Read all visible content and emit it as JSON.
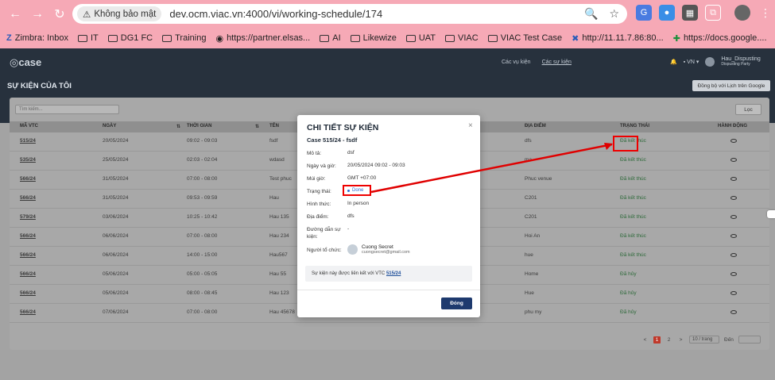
{
  "browser": {
    "security_label": "Không bảo mật",
    "url": "dev.ocm.viac.vn:4000/vi/working-schedule/174",
    "bookmarks": [
      "Zimbra: Inbox",
      "IT",
      "DG1 FC",
      "Training",
      "https://partner.elsas...",
      "AI",
      "Likewize",
      "UAT",
      "VIAC",
      "VIAC Test Case",
      "http://11.11.7.86:80...",
      "https://docs.google...."
    ]
  },
  "app": {
    "logo": "case",
    "nav": [
      "Các vụ kiện",
      "Các sự kiện"
    ],
    "language": "VN",
    "user_name": "Hau_Dispusting",
    "user_sub": "Dispusting Party",
    "page_title": "SỰ KIỆN CỦA TÔI",
    "sync_button": "Đồng bộ với Lịch trên Google",
    "search_placeholder": "Tìm kiếm...",
    "filter_button": "Lọc",
    "columns": [
      "MÃ VTC",
      "NGÀY",
      "THỜI GIAN",
      "TÊN",
      "ĐỊA ĐIỂM",
      "TRẠNG THÁI",
      "HÀNH ĐỘNG"
    ],
    "rows": [
      {
        "code": "515/24",
        "date": "20/05/2024",
        "time": "09:02 - 09:03",
        "name": "fsdf",
        "place": "dfs",
        "status": "Đã kết thúc"
      },
      {
        "code": "535/24",
        "date": "25/05/2024",
        "time": "02:03 - 02:04",
        "name": "wdasd",
        "place": "ma",
        "status": "Đã kết thúc"
      },
      {
        "code": "566/24",
        "date": "31/05/2024",
        "time": "07:00 - 08:00",
        "name": "Test phuc",
        "place": "Phuc venue",
        "status": "Đã kết thúc"
      },
      {
        "code": "566/24",
        "date": "31/05/2024",
        "time": "09:53 - 09:59",
        "name": "Hau",
        "place": "C201",
        "status": "Đã kết thúc"
      },
      {
        "code": "579/24",
        "date": "03/06/2024",
        "time": "10:25 - 10:42",
        "name": "Hau 135",
        "place": "C201",
        "status": "Đã kết thúc"
      },
      {
        "code": "566/24",
        "date": "06/06/2024",
        "time": "07:00 - 08:00",
        "name": "Hau 234",
        "place": "Hoi An",
        "status": "Đã kết thúc"
      },
      {
        "code": "566/24",
        "date": "06/06/2024",
        "time": "14:00 - 15:00",
        "name": "Hau567",
        "place": "hue",
        "status": "Đã kết thúc"
      },
      {
        "code": "566/24",
        "date": "05/06/2024",
        "time": "05:00 - 05:05",
        "name": "Hau 55",
        "place": "Home",
        "status": "Đã hủy"
      },
      {
        "code": "566/24",
        "date": "05/06/2024",
        "time": "08:00 - 08:45",
        "name": "Hau 123",
        "place": "Hue",
        "status": "Đã hủy"
      },
      {
        "code": "566/24",
        "date": "07/06/2024",
        "time": "07:00 - 08:00",
        "name": "Hau 45678",
        "place": "phu my",
        "status": "Đã hủy"
      }
    ],
    "pagination": {
      "prev": "<",
      "pages": [
        "1",
        "2"
      ],
      "next": ">",
      "page_size": "10 / trang",
      "goto_label": "Đến"
    }
  },
  "modal": {
    "title": "CHI TIẾT SỰ KIỆN",
    "close": "×",
    "case_line": "Case 515/24 - fsdf",
    "fields": [
      {
        "label": "Mô tả:",
        "value": "dsf"
      },
      {
        "label": "Ngày và giờ:",
        "value": "20/05/2024 09:02 - 09:03"
      },
      {
        "label": "Múi giờ:",
        "value": "GMT +07:00"
      },
      {
        "label": "Trạng thái:",
        "value": "Done"
      },
      {
        "label": "Hình thức:",
        "value": "In person"
      },
      {
        "label": "Địa điểm:",
        "value": "dfs"
      },
      {
        "label": "Đường dẫn sự kiện:",
        "value": "-"
      },
      {
        "label": "Người tổ chức:",
        "value": ""
      }
    ],
    "organizer_name": "Cuong Secret",
    "organizer_email": "cuongsecret@gmail.com",
    "note_prefix": "Sự kiện này được liên kết với VTC",
    "note_link": "515/24",
    "button": "Đóng"
  },
  "colors": {
    "annotation": "#e00000",
    "primary_button": "#1e3a6e",
    "done_chip": "#2a6ad3"
  }
}
